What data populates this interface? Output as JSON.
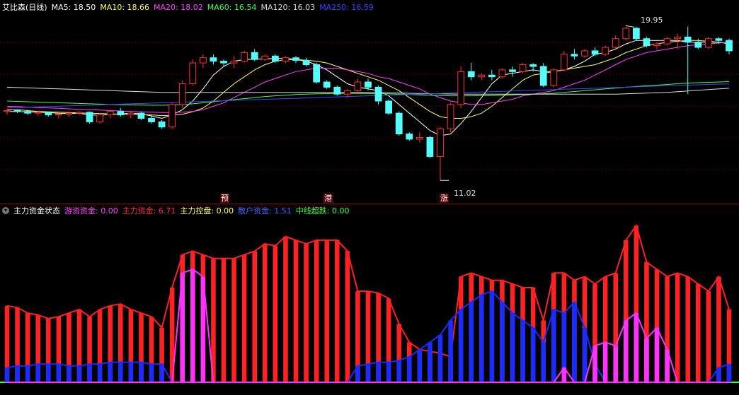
{
  "main_panel": {
    "title": "艾比森(日线)",
    "indicators": [
      {
        "label": "MA5: 18.50",
        "color": "#ffffff"
      },
      {
        "label": "MA10: 18.66",
        "color": "#ffff66"
      },
      {
        "label": "MA20: 18.02",
        "color": "#ff44ff"
      },
      {
        "label": "MA60: 16.54",
        "color": "#44ff44"
      },
      {
        "label": "MA120: 16.03",
        "color": "#dddddd"
      },
      {
        "label": "MA250: 16.59",
        "color": "#4444ff"
      }
    ],
    "high_label": "19.95",
    "low_label": "11.02",
    "signals": [
      "预",
      "港",
      "涨"
    ]
  },
  "indicator_panel": {
    "title": "主力资金状态",
    "icon": "chevron-down-icon",
    "indicators": [
      {
        "label": "游资资金: 0.00",
        "color": "#ff44ff"
      },
      {
        "label": "主力资金: 6.71",
        "color": "#ff3333"
      },
      {
        "label": "主力控盘: 0.00",
        "color": "#ffff66"
      },
      {
        "label": "散户资金: 1.51",
        "color": "#4466ff"
      },
      {
        "label": "中线超跌: 0.00",
        "color": "#44ff44"
      }
    ]
  },
  "chart_data": {
    "type": "candlestick",
    "ohlc": [
      [
        15.0,
        15.1,
        14.8,
        15.05
      ],
      [
        15.05,
        15.1,
        14.9,
        15.0
      ],
      [
        15.0,
        15.1,
        14.8,
        14.9
      ],
      [
        14.9,
        15.05,
        14.75,
        14.95
      ],
      [
        14.95,
        15.0,
        14.7,
        14.8
      ],
      [
        14.8,
        14.9,
        14.6,
        14.85
      ],
      [
        14.85,
        15.0,
        14.7,
        14.9
      ],
      [
        14.9,
        15.0,
        14.8,
        14.95
      ],
      [
        14.95,
        15.0,
        14.3,
        14.4
      ],
      [
        14.4,
        14.9,
        14.3,
        14.8
      ],
      [
        14.8,
        15.1,
        14.6,
        15.0
      ],
      [
        15.0,
        15.2,
        14.7,
        14.8
      ],
      [
        14.8,
        15.0,
        14.6,
        14.9
      ],
      [
        14.9,
        15.0,
        14.5,
        14.6
      ],
      [
        14.6,
        14.8,
        14.3,
        14.4
      ],
      [
        14.4,
        14.5,
        14.0,
        14.1
      ],
      [
        14.1,
        15.5,
        14.0,
        15.4
      ],
      [
        15.4,
        16.8,
        15.2,
        16.6
      ],
      [
        16.6,
        18.0,
        16.5,
        17.8
      ],
      [
        17.8,
        18.3,
        17.5,
        18.1
      ],
      [
        18.1,
        18.3,
        17.7,
        17.9
      ],
      [
        17.9,
        18.0,
        17.6,
        17.8
      ],
      [
        17.8,
        18.2,
        17.5,
        17.9
      ],
      [
        17.9,
        18.5,
        17.8,
        18.4
      ],
      [
        18.4,
        18.6,
        17.9,
        18.0
      ],
      [
        18.0,
        18.3,
        17.9,
        18.2
      ],
      [
        18.2,
        18.3,
        17.8,
        17.9
      ],
      [
        17.9,
        18.2,
        17.8,
        18.1
      ],
      [
        18.1,
        18.2,
        17.8,
        17.95
      ],
      [
        17.95,
        18.1,
        17.6,
        17.7
      ],
      [
        17.7,
        17.8,
        16.6,
        16.7
      ],
      [
        16.7,
        16.8,
        16.3,
        16.4
      ],
      [
        16.4,
        16.5,
        15.9,
        16.0
      ],
      [
        16.0,
        16.3,
        15.8,
        16.2
      ],
      [
        16.2,
        16.9,
        16.0,
        16.7
      ],
      [
        16.7,
        16.9,
        16.2,
        16.4
      ],
      [
        16.4,
        16.5,
        15.4,
        15.6
      ],
      [
        15.6,
        15.7,
        14.8,
        14.9
      ],
      [
        14.9,
        15.0,
        13.6,
        13.7
      ],
      [
        13.7,
        13.8,
        13.3,
        13.4
      ],
      [
        13.4,
        13.8,
        13.2,
        13.5
      ],
      [
        13.5,
        13.6,
        12.3,
        12.4
      ],
      [
        12.4,
        14.1,
        11.02,
        14.0
      ],
      [
        14.0,
        15.5,
        13.8,
        15.4
      ],
      [
        15.4,
        17.6,
        15.2,
        17.3
      ],
      [
        17.3,
        17.8,
        16.8,
        17.0
      ],
      [
        17.0,
        17.2,
        16.8,
        17.1
      ],
      [
        17.1,
        17.4,
        16.8,
        17.0
      ],
      [
        17.0,
        17.5,
        16.9,
        17.4
      ],
      [
        17.4,
        17.6,
        17.0,
        17.3
      ],
      [
        17.3,
        17.8,
        17.2,
        17.7
      ],
      [
        17.7,
        17.8,
        17.3,
        17.6
      ],
      [
        17.6,
        17.8,
        16.4,
        16.5
      ],
      [
        16.5,
        17.5,
        16.4,
        17.4
      ],
      [
        17.4,
        18.5,
        17.3,
        18.3
      ],
      [
        18.3,
        18.6,
        18.0,
        18.2
      ],
      [
        18.2,
        18.6,
        18.1,
        18.5
      ],
      [
        18.5,
        18.7,
        18.2,
        18.3
      ],
      [
        18.3,
        18.8,
        18.2,
        18.7
      ],
      [
        18.7,
        19.4,
        18.6,
        19.2
      ],
      [
        19.2,
        19.95,
        19.1,
        19.8
      ],
      [
        19.8,
        19.9,
        19.1,
        19.2
      ],
      [
        19.2,
        19.3,
        18.7,
        18.8
      ],
      [
        18.8,
        19.0,
        18.6,
        18.9
      ],
      [
        18.9,
        19.3,
        18.8,
        19.2
      ],
      [
        19.2,
        19.5,
        18.6,
        19.3
      ],
      [
        19.3,
        19.9,
        16.0,
        19.0
      ],
      [
        19.0,
        19.2,
        18.6,
        18.7
      ],
      [
        18.7,
        19.3,
        18.6,
        19.2
      ],
      [
        19.2,
        19.3,
        18.9,
        19.1
      ],
      [
        19.1,
        19.2,
        18.3,
        18.5
      ]
    ],
    "y_range": [
      10.5,
      20.7
    ],
    "lines": {
      "MA5": [
        15.0,
        15.0,
        14.98,
        14.96,
        14.94,
        14.9,
        14.88,
        14.9,
        14.8,
        14.78,
        14.82,
        14.86,
        14.9,
        14.86,
        14.74,
        14.6,
        14.8,
        15.1,
        15.6,
        16.3,
        17.1,
        17.6,
        17.9,
        18.0,
        18.02,
        18.04,
        18.06,
        18.08,
        18.0,
        17.9,
        17.7,
        17.4,
        17.0,
        16.6,
        16.4,
        16.3,
        16.2,
        15.9,
        15.4,
        14.9,
        14.4,
        13.9,
        13.6,
        13.7,
        14.3,
        15.0,
        15.8,
        16.6,
        17.1,
        17.2,
        17.3,
        17.4,
        17.3,
        17.3,
        17.4,
        17.6,
        17.9,
        18.3,
        18.4,
        18.6,
        18.9,
        19.1,
        19.1,
        19.1,
        19.1,
        19.1,
        19.0,
        19.0,
        19.0,
        19.0,
        18.9
      ],
      "MA10": [
        15.1,
        15.1,
        15.05,
        15.0,
        14.98,
        14.96,
        14.94,
        14.92,
        14.9,
        14.88,
        14.86,
        14.84,
        14.84,
        14.82,
        14.8,
        14.76,
        14.78,
        14.84,
        14.98,
        15.2,
        15.6,
        16.1,
        16.6,
        17.0,
        17.4,
        17.7,
        17.9,
        18.0,
        18.0,
        17.96,
        17.9,
        17.8,
        17.6,
        17.4,
        17.2,
        17.0,
        16.8,
        16.5,
        16.2,
        15.8,
        15.4,
        15.0,
        14.7,
        14.6,
        14.6,
        14.7,
        14.9,
        15.3,
        15.8,
        16.3,
        16.8,
        17.1,
        17.2,
        17.3,
        17.4,
        17.5,
        17.6,
        17.7,
        17.9,
        18.1,
        18.4,
        18.6,
        18.8,
        18.9,
        19.0,
        19.05,
        19.1,
        19.1,
        19.05,
        19.0,
        18.95
      ],
      "MA20": [
        15.3,
        15.28,
        15.25,
        15.22,
        15.2,
        15.18,
        15.15,
        15.12,
        15.1,
        15.08,
        15.05,
        15.03,
        15.0,
        14.98,
        14.96,
        14.94,
        14.94,
        14.96,
        15.0,
        15.1,
        15.3,
        15.5,
        15.8,
        16.1,
        16.4,
        16.7,
        16.9,
        17.1,
        17.3,
        17.4,
        17.5,
        17.5,
        17.5,
        17.4,
        17.3,
        17.2,
        17.0,
        16.9,
        16.7,
        16.5,
        16.3,
        16.0,
        15.8,
        15.6,
        15.5,
        15.4,
        15.4,
        15.5,
        15.6,
        15.7,
        15.9,
        16.0,
        16.1,
        16.2,
        16.4,
        16.6,
        16.8,
        17.1,
        17.4,
        17.7,
        18.0,
        18.2,
        18.4,
        18.5,
        18.6,
        18.7,
        18.8,
        18.85,
        18.9,
        18.95,
        19.0
      ],
      "MA60": [
        15.6,
        15.58,
        15.56,
        15.54,
        15.52,
        15.5,
        15.48,
        15.46,
        15.44,
        15.42,
        15.4,
        15.39,
        15.38,
        15.37,
        15.36,
        15.36,
        15.37,
        15.4,
        15.44,
        15.5,
        15.56,
        15.62,
        15.68,
        15.74,
        15.8,
        15.86,
        15.9,
        15.94,
        15.98,
        16.0,
        16.02,
        16.03,
        16.04,
        16.04,
        16.04,
        16.04,
        16.03,
        16.02,
        16.0,
        15.98,
        15.96,
        15.94,
        15.92,
        15.9,
        15.9,
        15.9,
        15.91,
        15.92,
        15.94,
        15.96,
        15.98,
        16.0,
        16.02,
        16.05,
        16.1,
        16.15,
        16.2,
        16.25,
        16.3,
        16.35,
        16.4,
        16.44,
        16.48,
        16.52,
        16.56,
        16.6,
        16.63,
        16.66,
        16.68,
        16.7,
        16.72
      ],
      "MA120": [
        16.4,
        16.38,
        16.36,
        16.34,
        16.32,
        16.3,
        16.28,
        16.26,
        16.24,
        16.22,
        16.2,
        16.18,
        16.16,
        16.14,
        16.12,
        16.1,
        16.1,
        16.1,
        16.1,
        16.1,
        16.1,
        16.1,
        16.1,
        16.1,
        16.1,
        16.1,
        16.1,
        16.1,
        16.1,
        16.1,
        16.1,
        16.1,
        16.1,
        16.1,
        16.1,
        16.09,
        16.08,
        16.07,
        16.06,
        16.05,
        16.04,
        16.03,
        16.02,
        16.01,
        16.0,
        16.0,
        16.0,
        16.0,
        16.0,
        16.0,
        16.0,
        16.0,
        16.0,
        16.0,
        16.0,
        16.0,
        16.0,
        16.0,
        16.0,
        16.0,
        16.02,
        16.04,
        16.06,
        16.08,
        16.1,
        16.14,
        16.18,
        16.22,
        16.26,
        16.3,
        16.34
      ],
      "MA250": [
        15.2,
        15.22,
        15.24,
        15.26,
        15.28,
        15.3,
        15.32,
        15.34,
        15.36,
        15.38,
        15.4,
        15.42,
        15.44,
        15.46,
        15.48,
        15.5,
        15.52,
        15.54,
        15.56,
        15.58,
        15.6,
        15.62,
        15.64,
        15.66,
        15.68,
        15.7,
        15.72,
        15.74,
        15.76,
        15.78,
        15.8,
        15.82,
        15.84,
        15.86,
        15.88,
        15.9,
        15.92,
        15.94,
        15.96,
        15.98,
        16.0,
        16.02,
        16.04,
        16.06,
        16.08,
        16.1,
        16.12,
        16.14,
        16.16,
        16.18,
        16.2,
        16.22,
        16.24,
        16.26,
        16.28,
        16.3,
        16.32,
        16.34,
        16.36,
        16.38,
        16.4,
        16.42,
        16.44,
        16.46,
        16.48,
        16.5,
        16.52,
        16.54,
        16.56,
        16.58,
        16.59
      ]
    },
    "sub_bars": {
      "red": [
        42,
        41,
        38,
        37,
        35,
        36,
        38,
        40,
        36,
        40,
        42,
        43,
        40,
        38,
        36,
        30,
        52,
        70,
        72,
        70,
        68,
        68,
        68,
        70,
        72,
        76,
        75,
        80,
        78,
        76,
        78,
        78,
        78,
        72,
        50,
        50,
        49,
        46,
        32,
        22,
        18,
        17,
        16,
        14,
        58,
        60,
        58,
        56,
        56,
        54,
        52,
        52,
        34,
        60,
        60,
        56,
        58,
        54,
        58,
        60,
        78,
        86,
        66,
        62,
        58,
        60,
        58,
        54,
        50,
        58,
        40
      ],
      "magenta": [
        0,
        0,
        0,
        0,
        0,
        0,
        0,
        0,
        0,
        0,
        0,
        0,
        0,
        0,
        0,
        0,
        0,
        60,
        62,
        58,
        0,
        0,
        0,
        0,
        0,
        0,
        0,
        0,
        0,
        0,
        0,
        0,
        0,
        0,
        0,
        0,
        0,
        0,
        0,
        0,
        0,
        0,
        0,
        0,
        0,
        0,
        0,
        0,
        0,
        0,
        0,
        0,
        0,
        0,
        0,
        0,
        0,
        0,
        0,
        0,
        0,
        0,
        0,
        0,
        0,
        0,
        0,
        0,
        0,
        0,
        0
      ],
      "blue": [
        8,
        9,
        9,
        10,
        10,
        10,
        9,
        9,
        10,
        10,
        11,
        11,
        11,
        11,
        10,
        10,
        0,
        0,
        0,
        0,
        0,
        0,
        0,
        0,
        0,
        0,
        0,
        0,
        0,
        0,
        0,
        0,
        0,
        0,
        9,
        10,
        11,
        11,
        12,
        14,
        18,
        22,
        26,
        34,
        40,
        44,
        48,
        50,
        44,
        38,
        34,
        30,
        22,
        40,
        38,
        44,
        30,
        10,
        0,
        0,
        0,
        0,
        0,
        0,
        0,
        0,
        0,
        0,
        0,
        8,
        10
      ],
      "sub_magenta_b": [
        0,
        0,
        0,
        0,
        0,
        0,
        0,
        0,
        0,
        0,
        0,
        0,
        0,
        0,
        0,
        0,
        0,
        0,
        0,
        0,
        0,
        0,
        0,
        0,
        0,
        0,
        0,
        0,
        0,
        0,
        0,
        0,
        0,
        0,
        0,
        0,
        0,
        0,
        0,
        0,
        0,
        0,
        0,
        0,
        0,
        0,
        0,
        0,
        0,
        0,
        0,
        0,
        0,
        0,
        8,
        0,
        0,
        20,
        22,
        20,
        34,
        38,
        24,
        30,
        18,
        0,
        0,
        0,
        0,
        0,
        0
      ]
    },
    "sub_y_range": [
      0,
      90
    ]
  }
}
